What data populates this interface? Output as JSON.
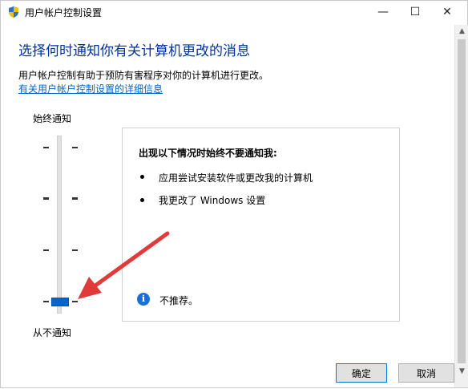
{
  "window": {
    "title": "用户帐户控制设置",
    "controls": {
      "minimize": "—",
      "maximize": "☐",
      "close": "✕"
    }
  },
  "main": {
    "heading": "选择何时通知你有关计算机更改的消息",
    "description": "用户帐户控制有助于预防有害程序对你的计算机进行更改。",
    "link": "有关用户帐户控制设置的详细信息"
  },
  "slider": {
    "top_label": "始终通知",
    "bottom_label": "从不通知",
    "levels": 4,
    "selected_level": 1
  },
  "info_panel": {
    "title": "出现以下情况时始终不要通知我:",
    "bullets": [
      "应用尝试安装软件或更改我的计算机",
      "我更改了 Windows 设置"
    ],
    "recommendation": "不推荐。"
  },
  "footer": {
    "ok_label": "确定",
    "cancel_label": "取消"
  },
  "colors": {
    "heading": "#003399",
    "link": "#0066cc",
    "accent": "#0a64c8",
    "annotation_arrow": "#e03a3a"
  },
  "icons": {
    "title": "shield-icon",
    "info": "info-icon"
  }
}
